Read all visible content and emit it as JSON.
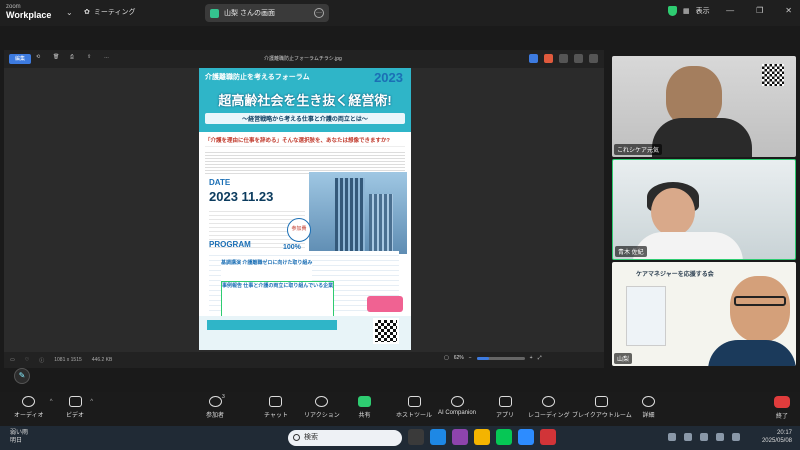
{
  "titlebar": {
    "app_line1": "zoom",
    "app_line2": "Workplace",
    "meeting_label": "ミーティング",
    "share_label": "山梨 さんの画面",
    "view_label": "表示"
  },
  "viewer": {
    "edit_label": "編集",
    "file_title": "介護離職防止フォーラムチラシ.jpg",
    "dimensions": "1081 x 1515",
    "filesize": "446.2 KB",
    "zoom": "62%"
  },
  "poster": {
    "forum": "介護離職防止を考えるフォーラム",
    "year": "2023",
    "headline": "超高齢社会を生き抜く経営術!",
    "subheadline": "〜経営戦略から考える仕事と介護の両立とは〜",
    "question": "「介護を理由に仕事を辞める」そんな選択肢を、あなたは想像できますか?",
    "date_label": "DATE",
    "date": "2023 11.23",
    "program_label": "PROGRAM",
    "program_1": "基調講演 介護離職ゼロに向けた取り組み",
    "program_2": "事例報告 仕事と介護の両立に取り組んでいる企業",
    "badge": "参加費",
    "badge_value": "100%"
  },
  "participants": [
    {
      "name": "これシケア元気"
    },
    {
      "name": "青木 佐紀"
    },
    {
      "name": "山梨"
    }
  ],
  "participant3_sign": "ケアマネジャーを応援する会",
  "toolbar": {
    "audio": "オーディオ",
    "video": "ビデオ",
    "participants": "参加者",
    "participants_count": "3",
    "chat": "チャット",
    "reactions": "リアクション",
    "share": "共有",
    "host_tools": "ホストツール",
    "ai": "AI Companion",
    "apps": "アプリ",
    "record": "レコーディング",
    "breakout": "ブレイクアウトルーム",
    "more": "詳細",
    "leave": "終了"
  },
  "taskbar": {
    "weather_line1": "弱い雨",
    "weather_line2": "明日",
    "search_placeholder": "検索",
    "time": "20:17",
    "date": "2025/05/08"
  },
  "colors": {
    "accent": "#3d7be0",
    "leave": "#e03c3c",
    "share_green": "#2ecc71",
    "poster_teal": "#2fb5c8"
  }
}
